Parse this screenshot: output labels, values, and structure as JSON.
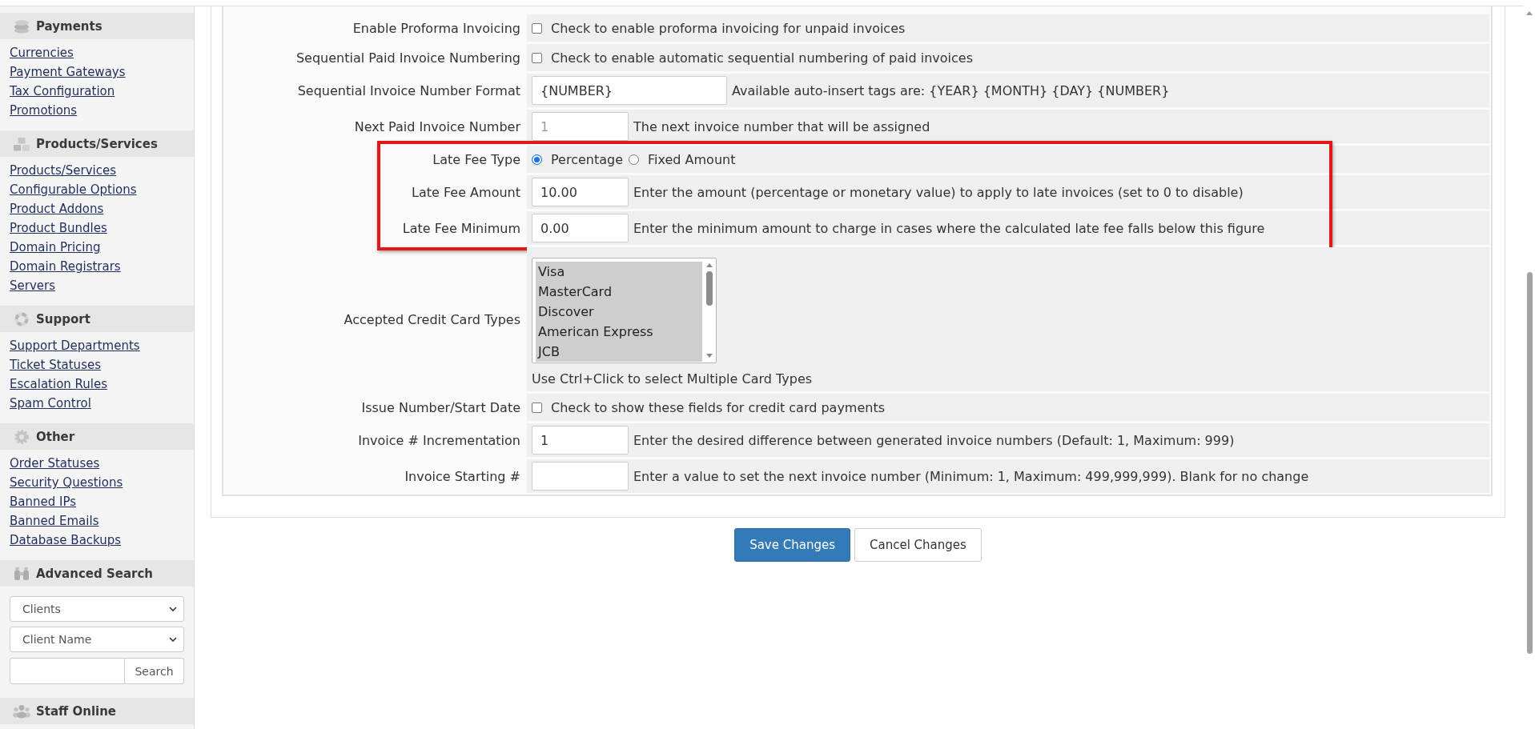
{
  "sidebar": {
    "sections": [
      {
        "kind": "links",
        "title": "Payments",
        "links": [
          "Currencies",
          "Payment Gateways",
          "Tax Configuration",
          "Promotions"
        ]
      },
      {
        "kind": "links",
        "title": "Products/Services",
        "links": [
          "Products/Services",
          "Configurable Options",
          "Product Addons",
          "Product Bundles",
          "Domain Pricing",
          "Domain Registrars",
          "Servers"
        ]
      },
      {
        "kind": "links",
        "title": "Support",
        "links": [
          "Support Departments",
          "Ticket Statuses",
          "Escalation Rules",
          "Spam Control"
        ]
      },
      {
        "kind": "links",
        "title": "Other",
        "links": [
          "Order Statuses",
          "Security Questions",
          "Banned IPs",
          "Banned Emails",
          "Database Backups"
        ]
      },
      {
        "kind": "search",
        "title": "Advanced Search",
        "selects": [
          "Clients",
          "Client Name"
        ],
        "button": "Search"
      },
      {
        "kind": "header",
        "title": "Staff Online"
      }
    ]
  },
  "form": {
    "rows": [
      {
        "label": "Enable Proforma Invoicing",
        "kind": "checkbox",
        "checked": false,
        "description": "Check to enable proforma invoicing for unpaid invoices",
        "highlighted": false
      },
      {
        "label": "Sequential Paid Invoice Numbering",
        "kind": "checkbox",
        "checked": false,
        "description": "Check to enable automatic sequential numbering of paid invoices",
        "highlighted": false
      },
      {
        "label": "Sequential Invoice Number Format",
        "kind": "text",
        "value": "{NUMBER}",
        "description": "Available auto-insert tags are: {YEAR} {MONTH} {DAY} {NUMBER}",
        "highlighted": false
      },
      {
        "label": "Next Paid Invoice Number",
        "kind": "number",
        "placeholder": "1",
        "description": "The next invoice number that will be assigned",
        "highlighted": false
      },
      {
        "label": "Late Fee Type",
        "kind": "radio",
        "options": [
          {
            "label": "Percentage",
            "selected": true
          },
          {
            "label": "Fixed Amount",
            "selected": false
          }
        ],
        "highlighted": true
      },
      {
        "label": "Late Fee Amount",
        "kind": "number",
        "value": "10.00",
        "description": "Enter the amount (percentage or monetary value) to apply to late invoices (set to 0 to disable)",
        "highlighted": true
      },
      {
        "label": "Late Fee Minimum",
        "kind": "number",
        "value": "0.00",
        "description": "Enter the minimum amount to charge in cases where the calculated late fee falls below this figure",
        "highlighted": true
      },
      {
        "label": "Accepted Credit Card Types",
        "kind": "multiselect",
        "options": [
          {
            "label": "Visa",
            "selected": true
          },
          {
            "label": "MasterCard",
            "selected": true
          },
          {
            "label": "Discover",
            "selected": true
          },
          {
            "label": "American Express",
            "selected": true
          },
          {
            "label": "JCB",
            "selected": true
          }
        ],
        "description": "Use Ctrl+Click to select Multiple Card Types",
        "highlighted": false
      },
      {
        "label": "Issue Number/Start Date",
        "kind": "checkbox",
        "checked": false,
        "description": "Check to show these fields for credit card payments",
        "highlighted": false
      },
      {
        "label": "Invoice # Incrementation",
        "kind": "number",
        "value": "1",
        "description": "Enter the desired difference between generated invoice numbers (Default: 1, Maximum: 999)",
        "highlighted": false
      },
      {
        "label": "Invoice Starting #",
        "kind": "number",
        "description": "Enter a value to set the next invoice number (Minimum: 1, Maximum: 499,999,999). Blank for no change",
        "highlighted": false
      }
    ]
  },
  "buttons": [
    {
      "label": "Save Changes",
      "kind": "primary"
    },
    {
      "label": "Cancel Changes",
      "kind": "default"
    }
  ]
}
